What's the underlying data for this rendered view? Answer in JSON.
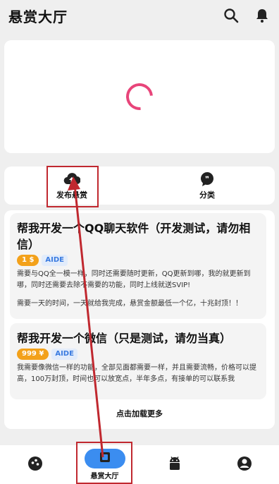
{
  "header": {
    "title": "悬赏大厅",
    "search_icon": "search-icon",
    "bell_icon": "bell-icon"
  },
  "banner": {
    "state": "loading",
    "spinner_color": "#e8457a"
  },
  "quick_actions": [
    {
      "label": "发布悬赏",
      "icon": "cloud-upload-icon"
    },
    {
      "label": "分类",
      "icon": "quote-bubble-icon"
    }
  ],
  "posts": [
    {
      "title": "帮我开发一个QQ聊天软件（开发测试，请勿相信）",
      "price": "1 $",
      "lang": "AIDE",
      "body": [
        "需要与QQ全一模一样，同时还需要随时更新，QQ更新到哪，我的就更新到哪，同时还需要去除不需要的功能，同时上线就送SVIP!",
        "需要一天的时间，一天就给我完成，悬赏金额最低一个亿，十兆封顶！！"
      ]
    },
    {
      "title": "帮我开发一个微信（只是测试，请勿当真）",
      "price": "999 ¥",
      "lang": "AIDE",
      "body": [
        "我需要像微信一样的功能，全部见面都需要一样，并且需要流畅，价格可以提高，100万封顶，时间也可以放宽点，半年多点，有接单的可以联系我"
      ]
    }
  ],
  "load_more": "点击加载更多",
  "bottom_nav": [
    {
      "icon": "discover-icon",
      "label": ""
    },
    {
      "icon": "bounty-hall-icon",
      "label": "悬赏大厅",
      "active": true
    },
    {
      "icon": "android-icon",
      "label": ""
    },
    {
      "icon": "profile-icon",
      "label": ""
    }
  ],
  "colors": {
    "accent": "#3b8df0",
    "price": "#f3a11a",
    "annotation": "#c0282f"
  }
}
